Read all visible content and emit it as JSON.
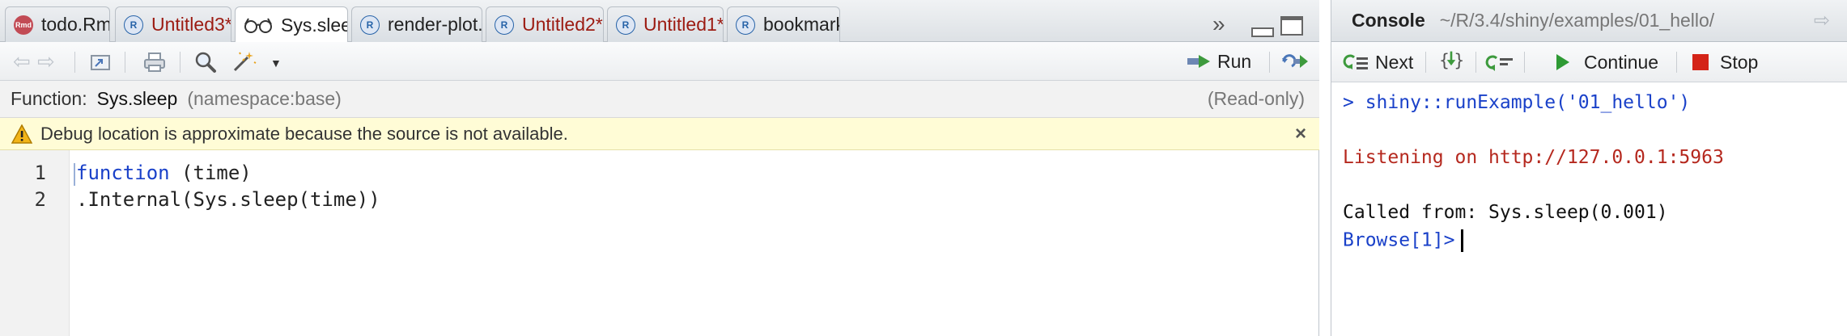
{
  "source_pane": {
    "tabs": [
      {
        "label": "todo.Rmd",
        "badge": "Rmd",
        "modified": false,
        "active": false
      },
      {
        "label": "Untitled3*",
        "badge": "R",
        "modified": true,
        "active": false
      },
      {
        "label": "Sys.sleep",
        "badge": "glasses",
        "modified": false,
        "active": true
      },
      {
        "label": "render-plot.R",
        "badge": "R",
        "modified": false,
        "active": false
      },
      {
        "label": "Untitled2*",
        "badge": "R",
        "modified": true,
        "active": false
      },
      {
        "label": "Untitled1*",
        "badge": "R",
        "modified": true,
        "active": false
      },
      {
        "label": "bookmark-st",
        "badge": "R",
        "modified": false,
        "active": false
      }
    ],
    "badge_rmd_text": "Rmd",
    "badge_r_text": "R",
    "tab_close_glyph": "×",
    "toolbar": {
      "run_label": "Run"
    },
    "function_bar": {
      "label": "Function:",
      "name": "Sys.sleep",
      "namespace": "(namespace:base)",
      "readonly": "(Read-only)"
    },
    "debug_notice": {
      "message": "Debug location is approximate because the source is not available.",
      "close_glyph": "×"
    },
    "code": {
      "line_numbers": [
        "1",
        "2"
      ],
      "lines": [
        {
          "keyword": "function",
          "rest": " (time)"
        },
        {
          "keyword": "",
          "rest": ".Internal(Sys.sleep(time))"
        }
      ]
    }
  },
  "console_pane": {
    "title": "Console",
    "path": "~/R/3.4/shiny/examples/01_hello/",
    "debug_toolbar": {
      "next_label": "Next",
      "continue_label": "Continue",
      "stop_label": "Stop"
    },
    "lines": {
      "command": "> shiny::runExample('01_hello')",
      "listening": "Listening on http://127.0.0.1:5963",
      "called_from": "Called from: Sys.sleep(0.001)",
      "prompt": "Browse[1]>"
    }
  },
  "colors": {
    "keyword_blue": "#1a41c9",
    "modified_red": "#9c1b12",
    "console_red": "#b5281e",
    "notice_yellow": "#fffcd6",
    "stop_red": "#d42418",
    "continue_green": "#2e9a34"
  }
}
